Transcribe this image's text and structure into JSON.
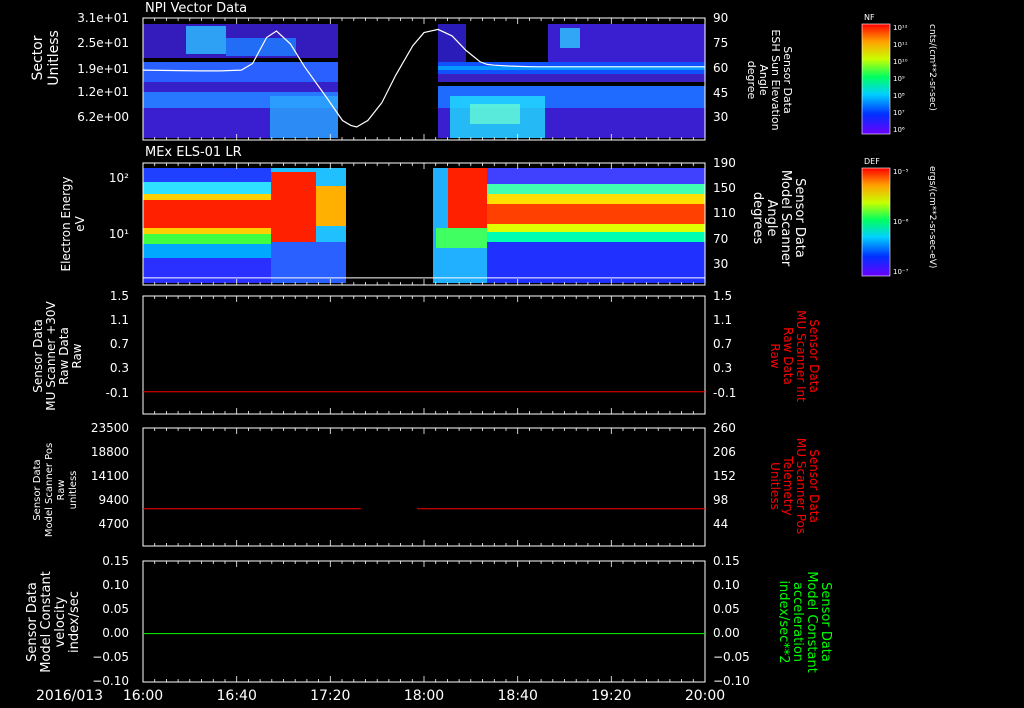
{
  "date_label": "2016/013",
  "time_ticks": [
    "16:00",
    "16:40",
    "17:20",
    "18:00",
    "18:40",
    "19:20",
    "20:00"
  ],
  "colors": {
    "background": "#000000",
    "axes": "#ffffff",
    "red_trace": "#ff0000",
    "green_trace": "#00ff00"
  },
  "chart_data": [
    {
      "type": "heatmap",
      "title": "NPI Vector Data",
      "ylabel": [
        "Sector",
        "Unitless"
      ],
      "yticks_left": [
        "3.1e+01",
        "2.5e+01",
        "1.9e+01",
        "1.2e+01",
        "6.2e+00"
      ],
      "ylabel_right": [
        "Sensor Data",
        "ESH Sun Elevation",
        "Angle",
        "degree"
      ],
      "yticks_right": [
        "90",
        "75",
        "60",
        "45",
        "30"
      ],
      "ylim_right": [
        15,
        90
      ],
      "overlay_line": {
        "name": "Sun Elevation Angle",
        "x": [
          0,
          0.2,
          0.4,
          0.55,
          0.7,
          0.78,
          0.83,
          0.88,
          0.95,
          1.05,
          1.15,
          1.3,
          1.42,
          1.48,
          1.52,
          1.6,
          1.7,
          1.8,
          1.92,
          2.0,
          2.1,
          2.2,
          2.3,
          2.4,
          2.45,
          2.5,
          2.6,
          2.7,
          2.8,
          2.9,
          3.0,
          3.2,
          3.5,
          3.8,
          4.0
        ],
        "y": [
          58,
          57.7,
          57.5,
          57.5,
          58,
          62,
          70,
          78,
          82,
          74,
          60,
          42,
          27,
          24,
          23,
          27,
          38,
          55,
          73,
          81,
          83,
          79,
          70,
          63,
          61.5,
          61,
          60.5,
          60.2,
          60,
          60,
          60,
          60,
          60,
          60,
          60
        ]
      },
      "colorbar": {
        "label": "NF",
        "units": "cnts/(cm**2-sr-sec)",
        "ticks": [
          "10¹²",
          "10¹¹",
          "10¹⁰",
          "10⁹",
          "10⁸",
          "10⁷",
          "10⁶"
        ]
      }
    },
    {
      "type": "heatmap",
      "title": "MEx ELS-01 LR",
      "ylabel": [
        "Electron Energy",
        "eV"
      ],
      "yticks_left": [
        "10²",
        "10¹"
      ],
      "ylabel_right": [
        "Sensor Data",
        "Model Scanner",
        "Angle",
        "degrees"
      ],
      "yticks_right": [
        "190",
        "150",
        "110",
        "70",
        "30"
      ],
      "ylim_right": [
        0,
        190
      ],
      "overlay_line": {
        "name": "Scanner Angle",
        "x": [
          0,
          4
        ],
        "y": [
          11,
          11
        ]
      },
      "colorbar": {
        "label": "DEF",
        "units": "ergs/(cm**2-sr-sec-eV)",
        "ticks": [
          "10⁻⁵",
          "10⁻⁶",
          "10⁻⁷"
        ]
      }
    },
    {
      "type": "line",
      "ylabel": [
        "Sensor Data",
        "MU Scanner +30V",
        "Raw Data",
        "Raw"
      ],
      "yticks_left": [
        "1.5",
        "1.1",
        "0.7",
        "0.3",
        "-0.1"
      ],
      "ylim": [
        -0.35,
        1.5
      ],
      "ylabel_right": [
        "Sensor Data",
        "MU Scanner Int",
        "Raw Data",
        "Raw"
      ],
      "yticks_right": [
        "1.5",
        "1.1",
        "0.7",
        "0.3",
        "-0.1"
      ],
      "series": [
        {
          "color": "#ff0000",
          "segments": [
            {
              "x": [
                0,
                4
              ],
              "y": [
                0.0,
                0.0
              ]
            }
          ]
        }
      ]
    },
    {
      "type": "line",
      "ylabel": [
        "Sensor Data",
        "Model Scanner Pos",
        "Raw",
        "unitless"
      ],
      "yticks_left": [
        "23500",
        "18800",
        "14100",
        "9400",
        "4700"
      ],
      "ylim": [
        0,
        23500
      ],
      "ylabel_right": [
        "Sensor Data",
        "MU Scanner Pos",
        "Telemetry",
        "Unitless"
      ],
      "yticks_right": [
        "260",
        "206",
        "152",
        "98",
        "44"
      ],
      "series": [
        {
          "color": "#ff0000",
          "segments": [
            {
              "x": [
                0,
                1.55
              ],
              "y": [
                7400,
                7400
              ]
            },
            {
              "x": [
                1.95,
                4
              ],
              "y": [
                7400,
                7400
              ]
            }
          ]
        }
      ]
    },
    {
      "type": "line",
      "ylabel": [
        "Sensor Data",
        "Model Constant",
        "velocity",
        "index/sec"
      ],
      "yticks_left": [
        "0.15",
        "0.10",
        "0.05",
        "0.00",
        "−0.05",
        "−0.10"
      ],
      "ylim": [
        -0.1,
        0.15
      ],
      "ylabel_right": [
        "Sensor Data",
        "Model Constant",
        "acceleration",
        "index/sec**2"
      ],
      "yticks_right": [
        "0.15",
        "0.10",
        "0.05",
        "0.00",
        "−0.05",
        "−0.10"
      ],
      "series": [
        {
          "color": "#00ff00",
          "segments": [
            {
              "x": [
                0,
                4
              ],
              "y": [
                0.0,
                0.0
              ]
            }
          ]
        }
      ]
    }
  ]
}
